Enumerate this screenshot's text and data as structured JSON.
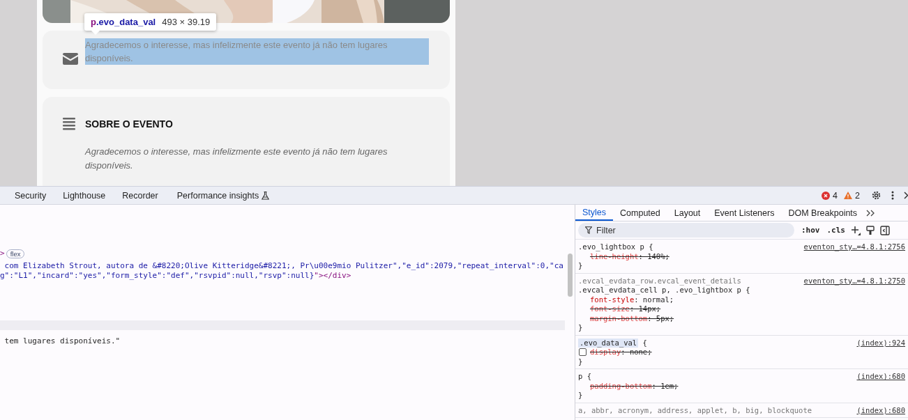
{
  "page": {
    "tooltip": {
      "element": "p",
      "class_name": ".evo_data_val",
      "size": "493 × 39.19"
    },
    "contact_card": {
      "text": "Agradecemos o interesse, mas infelizmente este evento já não tem lugares disponíveis.",
      "highlighted": true
    },
    "about_card": {
      "title": "SOBRE O EVENTO",
      "text": "Agradecemos o interesse, mas infelizmente este evento já não tem lugares disponíveis."
    }
  },
  "devtools": {
    "tabs": [
      {
        "label": "Security",
        "selected": false,
        "experimental": false
      },
      {
        "label": "Lighthouse",
        "selected": false,
        "experimental": false
      },
      {
        "label": "Recorder",
        "selected": false,
        "experimental": false
      },
      {
        "label": "Performance insights",
        "selected": false,
        "experimental": true
      }
    ],
    "errors": "4",
    "warnings": "2",
    "elements": {
      "lines": [
        {
          "kind": "badge",
          "segments": [
            {
              "kind": "tag",
              "text": ">"
            }
          ],
          "badge": "flex"
        },
        {
          "kind": "code",
          "segments": [
            {
              "kind": "value",
              "text": " com Elizabeth Strout, autora de &#8220;Olive Kitteridge&#8221;, Pr\\u00e9mio Pulitzer\",\"e_id\":2079,\"repeat_interval\":0,\"ca"
            }
          ]
        },
        {
          "kind": "code",
          "segments": [
            {
              "kind": "value",
              "text": "g\":\"L1\",\"incard\":\"yes\",\"form_style\":\"def\",\"rsvpid\":null,\"rsvp\":null}"
            },
            {
              "kind": "tag",
              "text": "\"></div>"
            }
          ]
        },
        {
          "kind": "selected"
        },
        {
          "kind": "code",
          "segments": [
            {
              "kind": "text",
              "text": " tem lugares disponíveis.\""
            }
          ]
        }
      ]
    },
    "sidebar_tabs": [
      {
        "label": "Styles",
        "selected": true
      },
      {
        "label": "Computed",
        "selected": false
      },
      {
        "label": "Layout",
        "selected": false
      },
      {
        "label": "Event Listeners",
        "selected": false
      },
      {
        "label": "DOM Breakpoints",
        "selected": false
      }
    ],
    "filter": {
      "placeholder": "Filter"
    },
    "toolbar": [
      ":hov",
      ".cls"
    ],
    "rules": [
      {
        "selectors": [
          {
            "text": ".evo_lightbox p {",
            "matched": true
          }
        ],
        "source": "eventon_sty…=4.8.1:2756",
        "highlighted": false,
        "declarations": [
          {
            "property": "line-height",
            "value": ": 140%;",
            "overridden": true,
            "has_checkbox": false
          }
        ],
        "close": "}"
      },
      {
        "selectors": [
          {
            "text": ".evcal_evdata_row.evcal_event_details",
            "matched": false
          },
          {
            "text": ".evcal_evdata_cell p, .evo_lightbox p {",
            "matched": true
          }
        ],
        "source": "eventon_sty…=4.8.1:2750",
        "highlighted": false,
        "declarations": [
          {
            "property": "font-style",
            "value": ": normal;",
            "overridden": false,
            "has_checkbox": false
          },
          {
            "property": "font-size",
            "value": ": 14px;",
            "overridden": true,
            "has_checkbox": false
          },
          {
            "property": "margin-bottom",
            "value": ": 5px;",
            "overridden": true,
            "has_checkbox": false
          }
        ],
        "close": "}"
      },
      {
        "selectors": [
          {
            "text": ".evo_data_val",
            "matched": true,
            "suffix": " {"
          }
        ],
        "source": "(index):924",
        "highlighted": true,
        "declarations": [
          {
            "property": "display",
            "value": ": none;",
            "overridden": true,
            "has_checkbox": true,
            "checked": false
          }
        ],
        "close": "}"
      },
      {
        "selectors": [
          {
            "text": "p {",
            "matched": true
          }
        ],
        "source": "(index):680",
        "highlighted": false,
        "declarations": [
          {
            "property": "padding-bottom",
            "value": ": 1em;",
            "overridden": true,
            "has_checkbox": false
          }
        ],
        "close": "}"
      },
      {
        "selectors": [
          {
            "text": "a, abbr, acronym, address, applet, b, big, blockquote",
            "matched": false
          }
        ],
        "source": "(index):680",
        "highlighted": false
      }
    ]
  }
}
